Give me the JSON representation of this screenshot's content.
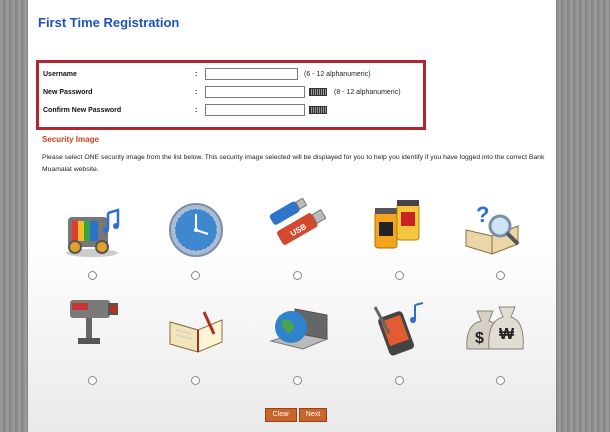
{
  "page": {
    "title": "First Time Registration"
  },
  "form": {
    "username": {
      "label": "Username",
      "hint": "(6 - 12 alphanumeric)",
      "value": ""
    },
    "new_password": {
      "label": "New Password",
      "hint": "(8 - 12 alphanumeric)",
      "value": ""
    },
    "confirm_password": {
      "label": "Confirm New Password",
      "value": ""
    },
    "colon": ":"
  },
  "security": {
    "title": "Security Image",
    "description": "Please select ONE security image from the list below.  This security image selected will be displayed for you to help you identify if you have logged into the correct Bank Muamalat website.",
    "images": [
      "tv-music-icon",
      "clock-icon",
      "usb-drive-icon",
      "film-canisters-icon",
      "book-magnifier-icon",
      "cctv-camera-icon",
      "notebook-pen-icon",
      "globe-laptop-icon",
      "mobile-phone-music-icon",
      "money-bags-icon"
    ]
  },
  "buttons": {
    "clear": "Clear",
    "next": "Next"
  },
  "colors": {
    "title": "#1d52b8",
    "accent_red": "#b3262e",
    "section_title": "#d0411c",
    "button": "#c9642a"
  }
}
